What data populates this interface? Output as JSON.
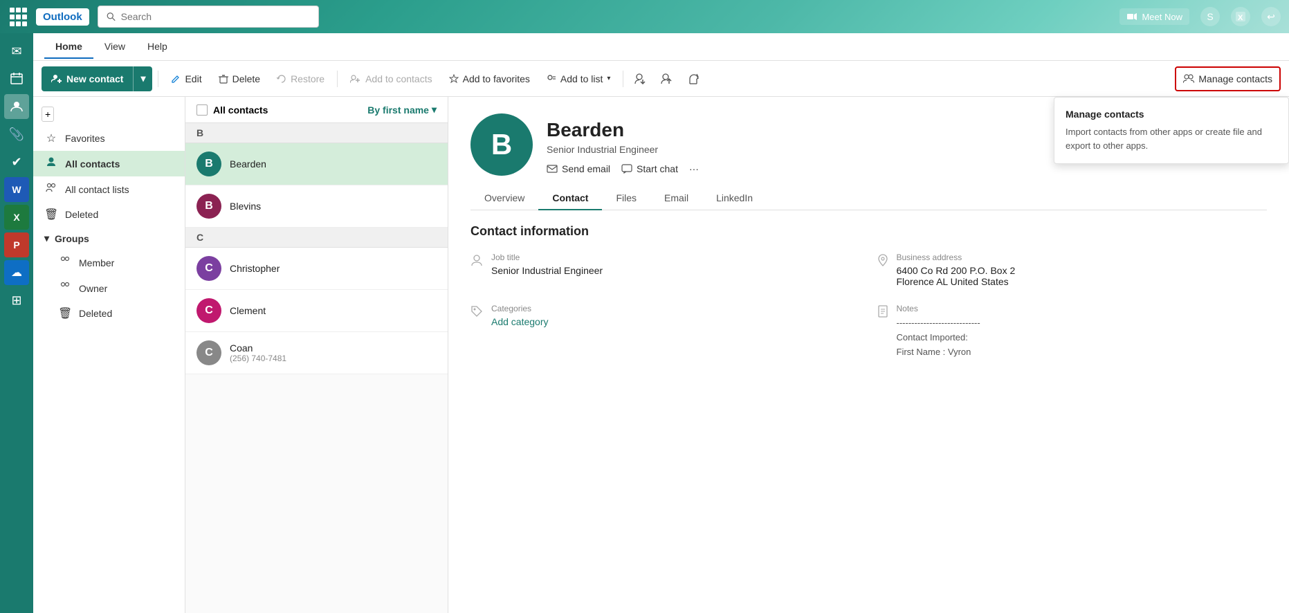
{
  "app": {
    "name": "Outlook"
  },
  "topbar": {
    "search_placeholder": "Search",
    "meet_now": "Meet Now"
  },
  "nav": {
    "tabs": [
      "Home",
      "View",
      "Help"
    ],
    "active": "Home"
  },
  "toolbar": {
    "new_contact": "New contact",
    "edit": "Edit",
    "delete": "Delete",
    "restore": "Restore",
    "add_to_contacts": "Add to contacts",
    "add_to_favorites": "Add to favorites",
    "add_to_list": "Add to list",
    "manage_contacts": "Manage contacts"
  },
  "sidebar": {
    "items": [
      {
        "id": "favorites",
        "label": "Favorites",
        "icon": "☆"
      },
      {
        "id": "all-contacts",
        "label": "All contacts",
        "icon": "👤"
      },
      {
        "id": "all-contact-lists",
        "label": "All contact lists",
        "icon": "👥"
      },
      {
        "id": "deleted",
        "label": "Deleted",
        "icon": "🗑"
      },
      {
        "id": "groups",
        "label": "Groups",
        "icon": "▾"
      },
      {
        "id": "member",
        "label": "Member",
        "icon": "👥",
        "indent": true
      },
      {
        "id": "owner",
        "label": "Owner",
        "icon": "👥",
        "indent": true
      },
      {
        "id": "groups-deleted",
        "label": "Deleted",
        "icon": "🗑",
        "indent": true
      }
    ]
  },
  "left_nav": {
    "icons": [
      {
        "id": "mail",
        "symbol": "✉"
      },
      {
        "id": "calendar",
        "symbol": "📅"
      },
      {
        "id": "contacts",
        "symbol": "👤",
        "active": true
      },
      {
        "id": "notes",
        "symbol": "📎"
      },
      {
        "id": "tasks",
        "symbol": "✔"
      },
      {
        "id": "word",
        "symbol": "W"
      },
      {
        "id": "excel",
        "symbol": "X"
      },
      {
        "id": "powerpoint",
        "symbol": "P"
      },
      {
        "id": "onedrive",
        "symbol": "☁"
      },
      {
        "id": "apps",
        "symbol": "⊞"
      }
    ]
  },
  "contact_list": {
    "header": "All contacts",
    "sort_label": "By first name",
    "letters": [
      {
        "letter": "B",
        "contacts": [
          {
            "name": "Bearden",
            "sub": "",
            "color": "#1a7a6e",
            "initial": "B",
            "selected": true
          },
          {
            "name": "Blevins",
            "sub": "",
            "color": "#8b2252",
            "initial": "B",
            "selected": false
          }
        ]
      },
      {
        "letter": "C",
        "contacts": [
          {
            "name": "Christopher",
            "sub": "",
            "color": "#7b3fa0",
            "initial": "C",
            "selected": false
          },
          {
            "name": "Clement",
            "sub": "",
            "color": "#c0186e",
            "initial": "C",
            "selected": false
          },
          {
            "name": "Coan",
            "sub": "(256) 740-7481",
            "color": "#888",
            "initial": "C",
            "selected": false
          }
        ]
      }
    ]
  },
  "contact_detail": {
    "avatar_initial": "B",
    "name": "Bearden",
    "title": "Senior Industrial Engineer",
    "actions": [
      {
        "id": "send-email",
        "label": "Send email",
        "icon": "✉"
      },
      {
        "id": "start-chat",
        "label": "Start chat",
        "icon": "💬"
      }
    ],
    "tabs": [
      {
        "id": "overview",
        "label": "Overview"
      },
      {
        "id": "contact",
        "label": "Contact",
        "active": true
      },
      {
        "id": "files",
        "label": "Files"
      },
      {
        "id": "email",
        "label": "Email"
      },
      {
        "id": "linkedin",
        "label": "LinkedIn"
      }
    ],
    "section_title": "Contact information",
    "fields": [
      {
        "id": "job-title",
        "label": "Job title",
        "value": "Senior Industrial Engineer",
        "icon": "👤"
      },
      {
        "id": "business-address",
        "label": "Business address",
        "value": "6400 Co Rd 200 P.O. Box 2\nFlorence AL United States",
        "icon": "📍"
      },
      {
        "id": "categories",
        "label": "Categories",
        "value": "",
        "action": "Add category",
        "icon": "🏷"
      },
      {
        "id": "notes",
        "label": "Notes",
        "value": "----------------------------\nContact Imported:\nFirst Name : Vyron",
        "icon": "📄"
      }
    ]
  },
  "manage_dropdown": {
    "title": "Manage contacts",
    "description": "Import contacts from other apps or create file and export to other apps."
  }
}
